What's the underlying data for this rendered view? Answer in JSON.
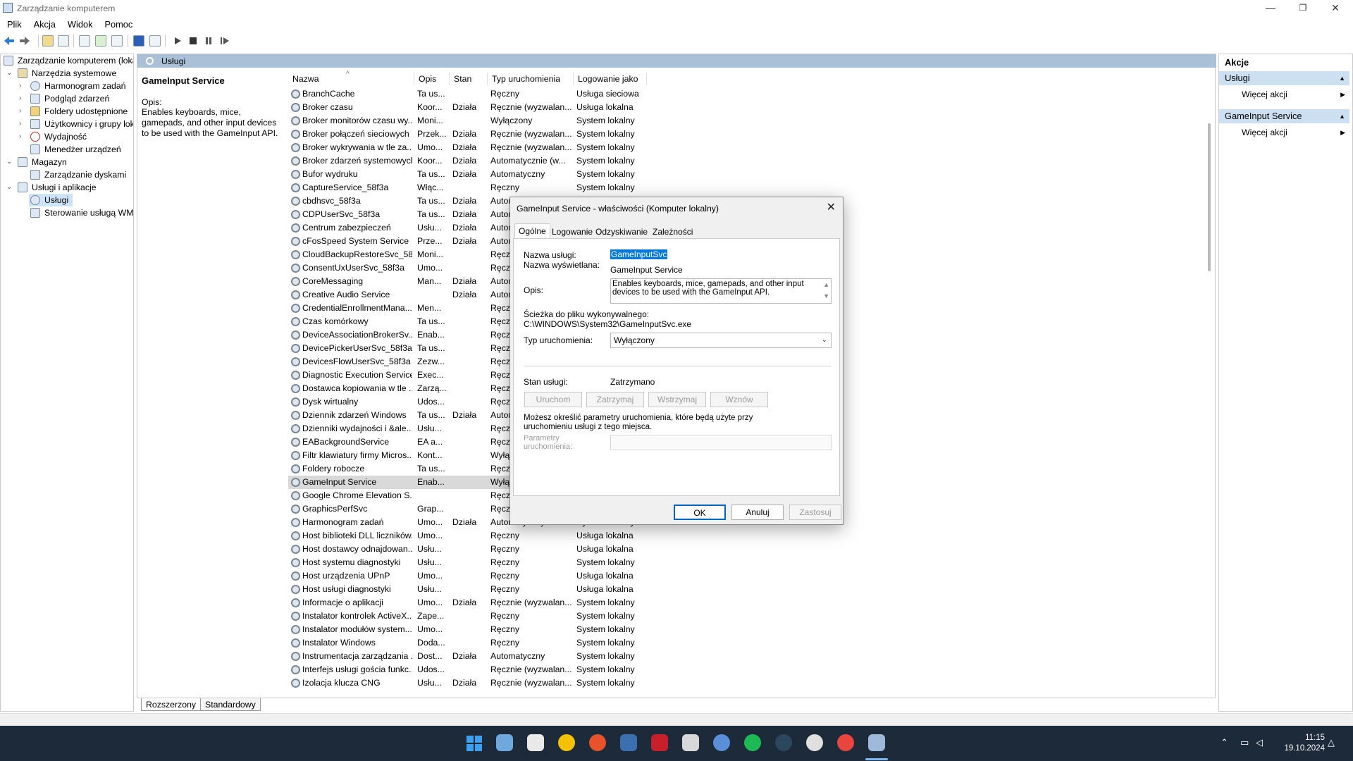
{
  "window": {
    "title": "Zarządzanie komputerem",
    "min": "—",
    "max": "❐",
    "close": "✕"
  },
  "menu": [
    "Plik",
    "Akcja",
    "Widok",
    "Pomoc"
  ],
  "tree": [
    {
      "label": "Zarządzanie komputerem (lokalne)",
      "level": 0,
      "arrow": ""
    },
    {
      "label": "Narzędzia systemowe",
      "level": 1,
      "arrow": "⌄"
    },
    {
      "label": "Harmonogram zadań",
      "level": 2,
      "arrow": "›"
    },
    {
      "label": "Podgląd zdarzeń",
      "level": 2,
      "arrow": "›"
    },
    {
      "label": "Foldery udostępnione",
      "level": 2,
      "arrow": "›"
    },
    {
      "label": "Użytkownicy i grupy lokalne",
      "level": 2,
      "arrow": "›"
    },
    {
      "label": "Wydajność",
      "level": 2,
      "arrow": "›"
    },
    {
      "label": "Menedżer urządzeń",
      "level": 2,
      "arrow": ""
    },
    {
      "label": "Magazyn",
      "level": 1,
      "arrow": "⌄"
    },
    {
      "label": "Zarządzanie dyskami",
      "level": 2,
      "arrow": ""
    },
    {
      "label": "Usługi i aplikacje",
      "level": 1,
      "arrow": "⌄"
    },
    {
      "label": "Usługi",
      "level": 2,
      "arrow": "",
      "selected": true
    },
    {
      "label": "Sterowanie usługą WMI",
      "level": 2,
      "arrow": ""
    }
  ],
  "panel": {
    "title": "Usługi"
  },
  "description": {
    "name": "GameInput Service",
    "label": "Opis:",
    "text": "Enables keyboards, mice, gamepads, and other input devices to be used with the GameInput API."
  },
  "columns": {
    "name": "Nazwa",
    "desc": "Opis",
    "status": "Stan",
    "startup": "Typ uruchomienia",
    "logon": "Logowanie jako",
    "sort_arrow": "^"
  },
  "services": [
    [
      "BranchCache",
      "Ta us...",
      "",
      "Ręczny",
      "Usługa sieciowa"
    ],
    [
      "Broker czasu",
      "Koor...",
      "Działa",
      "Ręcznie (wyzwalan...",
      "Usługa lokalna"
    ],
    [
      "Broker monitorów czasu wy...",
      "Moni...",
      "",
      "Wyłączony",
      "System lokalny"
    ],
    [
      "Broker połączeń sieciowych",
      "Przek...",
      "Działa",
      "Ręcznie (wyzwalan...",
      "System lokalny"
    ],
    [
      "Broker wykrywania w tle za...",
      "Umo...",
      "Działa",
      "Ręcznie (wyzwalan...",
      "System lokalny"
    ],
    [
      "Broker zdarzeń systemowych",
      "Koor...",
      "Działa",
      "Automatycznie (w...",
      "System lokalny"
    ],
    [
      "Bufor wydruku",
      "Ta us...",
      "Działa",
      "Automatyczny",
      "System lokalny"
    ],
    [
      "CaptureService_58f3a",
      "Włąc...",
      "",
      "Ręczny",
      "System lokalny"
    ],
    [
      "cbdhsvc_58f3a",
      "Ta us...",
      "Działa",
      "Autor",
      ""
    ],
    [
      "CDPUserSvc_58f3a",
      "Ta us...",
      "Działa",
      "Autor",
      ""
    ],
    [
      "Centrum zabezpieczeń",
      "Usłu...",
      "Działa",
      "Autor",
      ""
    ],
    [
      "cFosSpeed System Service",
      "Prze...",
      "Działa",
      "Autor",
      ""
    ],
    [
      "CloudBackupRestoreSvc_58...",
      "Moni...",
      "",
      "Ręczr",
      ""
    ],
    [
      "ConsentUxUserSvc_58f3a",
      "Umo...",
      "",
      "Ręczr",
      ""
    ],
    [
      "CoreMessaging",
      "Man...",
      "Działa",
      "Autor",
      ""
    ],
    [
      "Creative Audio Service",
      "",
      "Działa",
      "Autor",
      ""
    ],
    [
      "CredentialEnrollmentMana...",
      "Men...",
      "",
      "Ręczr",
      ""
    ],
    [
      "Czas komórkowy",
      "Ta us...",
      "",
      "Ręczr",
      ""
    ],
    [
      "DeviceAssociationBrokerSv...",
      "Enab...",
      "",
      "Ręczr",
      ""
    ],
    [
      "DevicePickerUserSvc_58f3a",
      "Ta us...",
      "",
      "Ręczr",
      ""
    ],
    [
      "DevicesFlowUserSvc_58f3a",
      "Zezw...",
      "",
      "Ręczr",
      ""
    ],
    [
      "Diagnostic Execution Service",
      "Exec...",
      "",
      "Ręczr",
      ""
    ],
    [
      "Dostawca kopiowania w tle ...",
      "Zarzą...",
      "",
      "Ręczr",
      ""
    ],
    [
      "Dysk wirtualny",
      "Udos...",
      "",
      "Ręczr",
      ""
    ],
    [
      "Dziennik zdarzeń Windows",
      "Ta us...",
      "Działa",
      "Autor",
      ""
    ],
    [
      "Dzienniki wydajności i &ale...",
      "Usłu...",
      "",
      "Ręczr",
      ""
    ],
    [
      "EABackgroundService",
      "EA a...",
      "",
      "Ręczr",
      ""
    ],
    [
      "Filtr klawiatury firmy Micros...",
      "Kont...",
      "",
      "Wyłą",
      ""
    ],
    [
      "Foldery robocze",
      "Ta us...",
      "",
      "Ręczr",
      ""
    ],
    [
      "GameInput Service",
      "Enab...",
      "",
      "Wyłą",
      ""
    ],
    [
      "Google Chrome Elevation S...",
      "",
      "",
      "Ręczr",
      ""
    ],
    [
      "GraphicsPerfSvc",
      "Grap...",
      "",
      "Ręczr",
      ""
    ],
    [
      "Harmonogram zadań",
      "Umo...",
      "Działa",
      "Automatyczny",
      "System lokalny"
    ],
    [
      "Host biblioteki DLL liczników...",
      "Umo...",
      "",
      "Ręczny",
      "Usługa lokalna"
    ],
    [
      "Host dostawcy odnajdowan...",
      "Usłu...",
      "",
      "Ręczny",
      "Usługa lokalna"
    ],
    [
      "Host systemu diagnostyki",
      "Usłu...",
      "",
      "Ręczny",
      "System lokalny"
    ],
    [
      "Host urządzenia UPnP",
      "Umo...",
      "",
      "Ręczny",
      "Usługa lokalna"
    ],
    [
      "Host usługi diagnostyki",
      "Usłu...",
      "",
      "Ręczny",
      "Usługa lokalna"
    ],
    [
      "Informacje o aplikacji",
      "Umo...",
      "Działa",
      "Ręcznie (wyzwalan...",
      "System lokalny"
    ],
    [
      "Instalator kontrolek ActiveX...",
      "Zape...",
      "",
      "Ręczny",
      "System lokalny"
    ],
    [
      "Instalator modułów system...",
      "Umo...",
      "",
      "Ręczny",
      "System lokalny"
    ],
    [
      "Instalator Windows",
      "Doda...",
      "",
      "Ręczny",
      "System lokalny"
    ],
    [
      "Instrumentacja zarządzania ...",
      "Dost...",
      "Działa",
      "Automatyczny",
      "System lokalny"
    ],
    [
      "Interfejs usługi gościa funkc...",
      "Udos...",
      "",
      "Ręcznie (wyzwalan...",
      "System lokalny"
    ],
    [
      "Izolacja klucza CNG",
      "Usłu...",
      "Działa",
      "Ręcznie (wyzwalan...",
      "System lokalny"
    ]
  ],
  "bottom_tabs": [
    "Rozszerzony",
    "Standardowy"
  ],
  "actions": {
    "header": "Akcje",
    "groups": [
      {
        "title": "Usługi",
        "item": "Więcej akcji"
      },
      {
        "title": "GameInput Service",
        "item": "Więcej akcji"
      }
    ]
  },
  "dialog": {
    "title": "GameInput Service - właściwości (Komputer lokalny)",
    "tabs": [
      "Ogólne",
      "Logowanie",
      "Odzyskiwanie",
      "Zależności"
    ],
    "service_name_label": "Nazwa usługi:",
    "service_name": "GameInputSvc",
    "display_name_label": "Nazwa wyświetlana:",
    "display_name": "GameInput Service",
    "desc_label": "Opis:",
    "desc": "Enables keyboards, mice, gamepads, and other input devices to be used with the GameInput API.",
    "path_label": "Ścieżka do pliku wykonywalnego:",
    "path": "C:\\WINDOWS\\System32\\GameInputSvc.exe",
    "startup_label": "Typ uruchomienia:",
    "startup_value": "Wyłączony",
    "status_label": "Stan usługi:",
    "status_value": "Zatrzymano",
    "btn_start": "Uruchom",
    "btn_stop": "Zatrzymaj",
    "btn_pause": "Wstrzymaj",
    "btn_resume": "Wznów",
    "params_hint": "Możesz określić parametry uruchomienia, które będą użyte przy uruchomieniu usługi z tego miejsca.",
    "params_label": "Parametry uruchomienia:",
    "ok": "OK",
    "cancel": "Anuluj",
    "apply": "Zastosuj"
  },
  "clock": {
    "time": "11:15",
    "date": "19.10.2024"
  }
}
